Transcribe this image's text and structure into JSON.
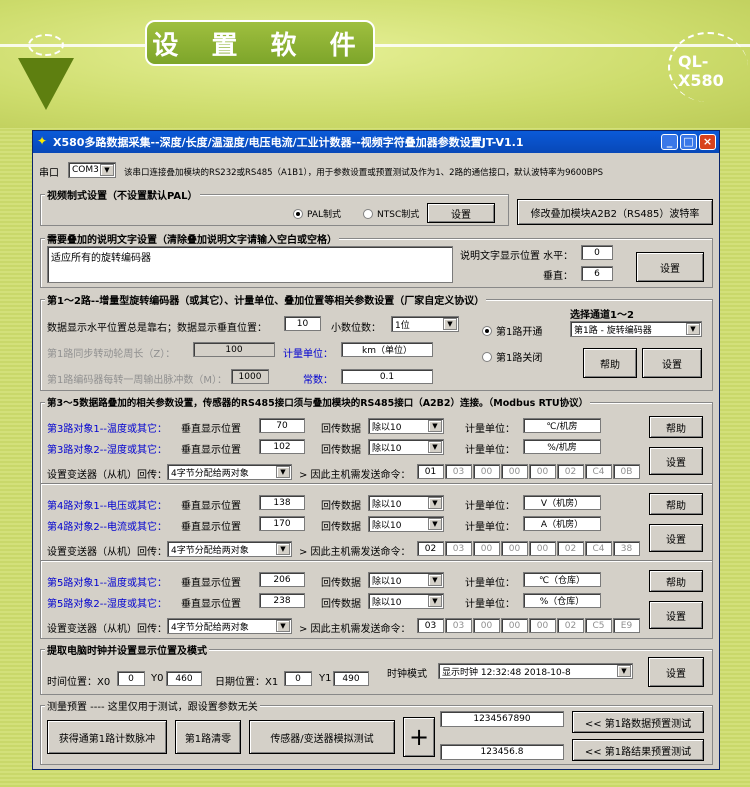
{
  "banner": {
    "title": "设 置 软 件",
    "brand": "QL-X580"
  },
  "window": {
    "title": "X580多路数据采集--深度/长度/温湿度/电压电流/工业计数器--视频字符叠加器参数设置JT-V1.1",
    "min": "_",
    "max": "□",
    "close": "×"
  },
  "serial": {
    "label": "串口",
    "value": "COM3",
    "desc": "该串口连接叠加模块的RS232或RS485（A1B1），用于参数设置或预置测试及作为1、2路的通信接口，默认波特率为9600BPS"
  },
  "video": {
    "group": "视频制式设置（不设置默认PAL）",
    "pal": "PAL制式",
    "ntsc": "NTSC制式",
    "set": "设置",
    "baud": "修改叠加模块A2B2（RS485）波特率"
  },
  "text": {
    "group": "需要叠加的说明文字设置（清除叠加说明文字请输入空白或空格）",
    "value": "适应所有的旋转编码器",
    "pos_label": "说明文字显示位置 水平：",
    "h": "0",
    "v_label": "垂直：",
    "v": "6",
    "set": "设置"
  },
  "enc": {
    "group": "第1～2路--增量型旋转编码器（或其它）、计量单位、叠加位置等相关参数设置（厂家自定义协议）",
    "note": "数据显示水平位置总是靠右；数据显示垂直位置：",
    "vpos": "10",
    "dec_label": "小数位数：",
    "dec": "1位",
    "circ_label": "第1路同步转动轮周长（Z）：",
    "circ": "100",
    "unit_label": "计量单位：",
    "unit": "km（单位）",
    "pulse_label": "第1路编码器每转一周输出脉冲数（M）：",
    "pulse": "1000",
    "const_label": "常数：",
    "const": "0.1",
    "on": "第1路开通",
    "off": "第1路关闭",
    "ch_label": "选择通道1～2",
    "ch": "第1路 - 旋转编码器",
    "help": "帮助",
    "set": "设置"
  },
  "ch35": {
    "group": "第3～5数据路叠加的相关参数设置，传感器的RS485接口须与叠加模块的RS485接口（A2B2）连接。（Modbus RTU协议）",
    "vpos_label": "垂直显示位置",
    "ret_label": "回传数据",
    "unit_label": "计量单位：",
    "dev_label": "设置变送器（从机）回传：",
    "cmd_label": "> 因此主机需发送命令：",
    "help": "帮助",
    "set": "设置",
    "blocks": [
      {
        "obj1": "第3路对象1--温度或其它：",
        "obj2": "第3路对象2--湿度或其它：",
        "v1": "70",
        "v2": "102",
        "r1": "除以10",
        "r2": "除以10",
        "u1": "℃/机房",
        "u2": "%/机房",
        "dev": "4字节分配给两对象",
        "cmd": [
          "01",
          "03",
          "00",
          "00",
          "00",
          "02",
          "C4",
          "0B"
        ]
      },
      {
        "obj1": "第4路对象1--电压或其它：",
        "obj2": "第4路对象2--电流或其它：",
        "v1": "138",
        "v2": "170",
        "r1": "除以10",
        "r2": "除以10",
        "u1": "V（机房）",
        "u2": "A（机房）",
        "dev": "4字节分配给两对象",
        "cmd": [
          "02",
          "03",
          "00",
          "00",
          "00",
          "02",
          "C4",
          "38"
        ]
      },
      {
        "obj1": "第5路对象1--温度或其它：",
        "obj2": "第5路对象2--湿度或其它：",
        "v1": "206",
        "v2": "238",
        "r1": "除以10",
        "r2": "除以10",
        "u1": "℃（仓库）",
        "u2": "%（仓库）",
        "dev": "4字节分配给两对象",
        "cmd": [
          "03",
          "03",
          "00",
          "00",
          "00",
          "02",
          "C5",
          "E9"
        ]
      }
    ]
  },
  "clock": {
    "group": "提取电脑时钟并设置显示位置及模式",
    "time_label": "时间位置：X0",
    "x0": "0",
    "y0_label": "Y0",
    "y0": "460",
    "date_label": "日期位置：X1",
    "x1": "0",
    "y1_label": "Y1",
    "y1": "490",
    "mode_label": "时钟模式",
    "mode": "显示时钟 12:32:48  2018-10-8",
    "set": "设置"
  },
  "test": {
    "group": "测量预置 ---- 这里仅用于测试，跟设置参数无关",
    "get": "获得通第1路计数脉冲",
    "clear": "第1路清零",
    "sim": "传感器/变送器模拟测试",
    "plus": "+",
    "val1": "1234567890",
    "val2": "123456.8",
    "t1": "<< 第1路数据预置测试",
    "t2": "<< 第1路结果预置测试"
  }
}
